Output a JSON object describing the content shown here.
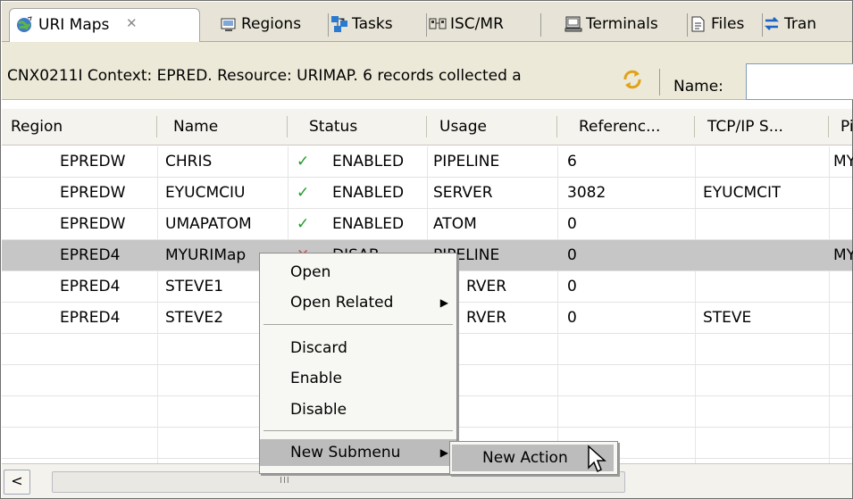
{
  "tabs": [
    {
      "label": "URI Maps",
      "icon": "globe-icon",
      "close": "✕"
    },
    {
      "label": "Regions",
      "icon": "regions-icon"
    },
    {
      "label": "Tasks",
      "icon": "tasks-icon"
    },
    {
      "label": "ISC/MR",
      "icon": "isc-icon"
    },
    {
      "label": "Terminals",
      "icon": "terminal-icon"
    },
    {
      "label": "Files",
      "icon": "files-icon"
    },
    {
      "label": "Tran",
      "icon": "transactions-icon"
    }
  ],
  "infobar": {
    "message": "CNX0211I Context: EPRED. Resource: URIMAP. 6 records collected a",
    "refresh_icon": "refresh-icon",
    "name_label": "Name:",
    "name_value": ""
  },
  "table": {
    "columns": [
      "Region",
      "Name",
      "Status",
      "Usage",
      "Referenc...",
      "TCP/IP S...",
      "Pi"
    ],
    "rows": [
      {
        "region": "EPREDW",
        "name": "CHRIS",
        "status_icon": "check-icon",
        "status": "ENABLED",
        "usage": "PIPELINE",
        "reference": "6",
        "tcpip": "",
        "pipeline": "MY"
      },
      {
        "region": "EPREDW",
        "name": "EYUCMCIU",
        "status_icon": "check-icon",
        "status": "ENABLED",
        "usage": "SERVER",
        "reference": "3082",
        "tcpip": "EYUCMCIT",
        "pipeline": ""
      },
      {
        "region": "EPREDW",
        "name": "UMAPATOM",
        "status_icon": "check-icon",
        "status": "ENABLED",
        "usage": "ATOM",
        "reference": "0",
        "tcpip": "",
        "pipeline": ""
      },
      {
        "region": "EPRED4",
        "name": "MYURIMap",
        "status_icon": "cross-icon",
        "status": "DISAB",
        "usage": "PIPELINE",
        "reference": "0",
        "tcpip": "",
        "pipeline": "MY"
      },
      {
        "region": "EPRED4",
        "name": "STEVE1",
        "status_icon": "",
        "status": "",
        "usage": "RVER",
        "reference": "0",
        "tcpip": "",
        "pipeline": ""
      },
      {
        "region": "EPRED4",
        "name": "STEVE2",
        "status_icon": "",
        "status": "",
        "usage": "RVER",
        "reference": "0",
        "tcpip": "STEVE",
        "pipeline": ""
      }
    ],
    "selected_row": 3
  },
  "context_menu": {
    "items": [
      "Open",
      "Open Related",
      "Discard",
      "Enable",
      "Disable",
      "New Submenu"
    ],
    "submenu_item": "New Action"
  },
  "scrollbar": {
    "left_arrow": "<",
    "grip": "III"
  },
  "colors": {
    "accent_check": "#1c9a25",
    "selection": "#c6c6c6",
    "tab_bg": "#e7e3d6"
  }
}
